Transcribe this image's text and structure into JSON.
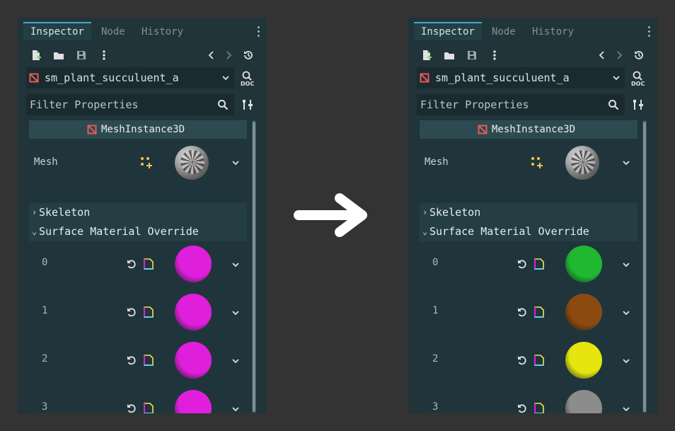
{
  "colors": {
    "background": "#333333",
    "panel": "#20343a",
    "mesh_icon_red": "#e55a5a",
    "accent_tab": "#4aa6c6",
    "add_icon_yellow": "#f2c744"
  },
  "panels": [
    {
      "tabs": [
        "Inspector",
        "Node",
        "History"
      ],
      "selected_object": "sm_plant_succuluent_a",
      "filter_placeholder": "Filter Properties",
      "class_name": "MeshInstance3D",
      "mesh_label": "Mesh",
      "sections": [
        "Skeleton",
        "Surface Material Override"
      ],
      "surfaces": [
        {
          "index": "0",
          "color": "#e01fdc"
        },
        {
          "index": "1",
          "color": "#e01fdc"
        },
        {
          "index": "2",
          "color": "#e01fdc"
        },
        {
          "index": "3",
          "color": "#e01fdc"
        }
      ]
    },
    {
      "tabs": [
        "Inspector",
        "Node",
        "History"
      ],
      "selected_object": "sm_plant_succuluent_a",
      "filter_placeholder": "Filter Properties",
      "class_name": "MeshInstance3D",
      "mesh_label": "Mesh",
      "sections": [
        "Skeleton",
        "Surface Material Override"
      ],
      "surfaces": [
        {
          "index": "0",
          "color": "#1fb830"
        },
        {
          "index": "1",
          "color": "#8a4a10"
        },
        {
          "index": "2",
          "color": "#e6e60e"
        },
        {
          "index": "3",
          "color": "#8c8c8c"
        }
      ]
    }
  ],
  "icons": {
    "transition_arrow": "right-arrow-icon"
  }
}
